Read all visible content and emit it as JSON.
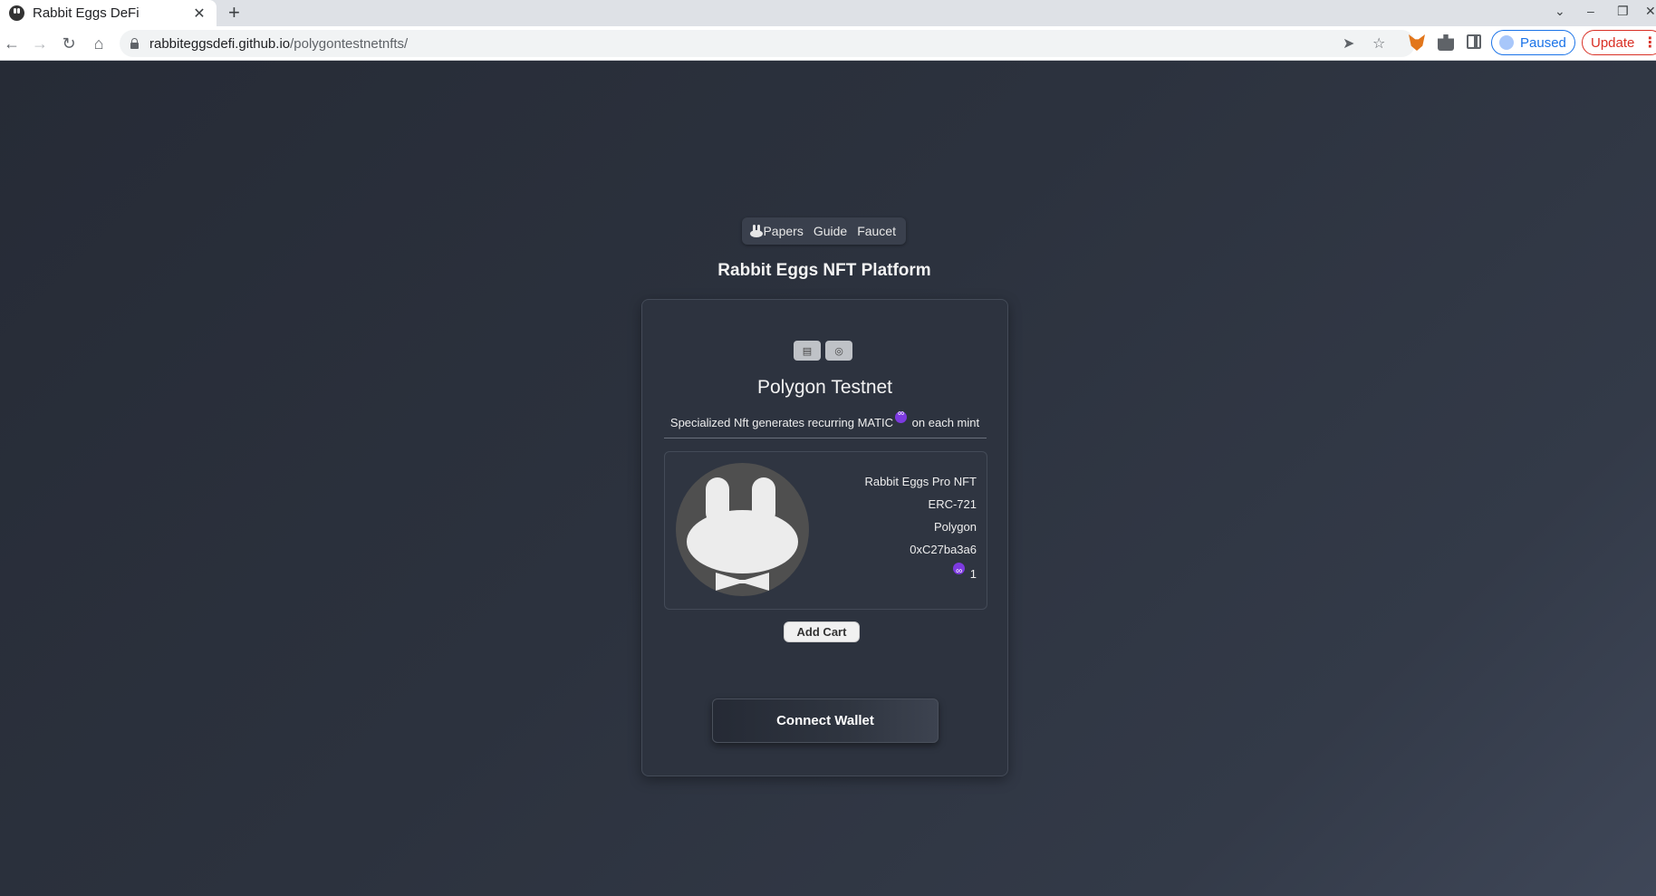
{
  "browser": {
    "tab_title": "Rabbit Eggs DeFi",
    "tab_close": "✕",
    "new_tab": "+",
    "url_host": "rabbiteggsdefi.github.io",
    "url_path": "/polygontestnetnfts/",
    "profile_status": "Paused",
    "update_label": "Update",
    "icons": [
      "back-icon",
      "forward-icon",
      "reload-icon",
      "home-icon",
      "lock-icon",
      "send-icon",
      "star-icon",
      "metamask-icon",
      "extensions-icon",
      "side-panel-icon",
      "more-icon"
    ]
  },
  "nav": {
    "links": [
      "Papers",
      "Guide",
      "Faucet"
    ]
  },
  "page": {
    "title": "Rabbit Eggs NFT Platform"
  },
  "card": {
    "network": "Polygon Testnet",
    "subtitle_before": "Specialized Nft generates recurring MATIC",
    "subtitle_after": " on each mint",
    "icon_buttons": [
      "document-icon",
      "settings-icon"
    ],
    "nft": {
      "name": "Rabbit Eggs Pro NFT",
      "standard": "ERC-721",
      "chain": "Polygon",
      "address": "0xC27ba3a6",
      "price": "1"
    },
    "add_cart_label": "Add Cart",
    "connect_label": "Connect Wallet"
  },
  "colors": {
    "background": "#2b313d",
    "card": "#2d333f",
    "matic": "#7d3ae0",
    "chrome_accent": "#1a73e8",
    "update_red": "#d93025"
  }
}
